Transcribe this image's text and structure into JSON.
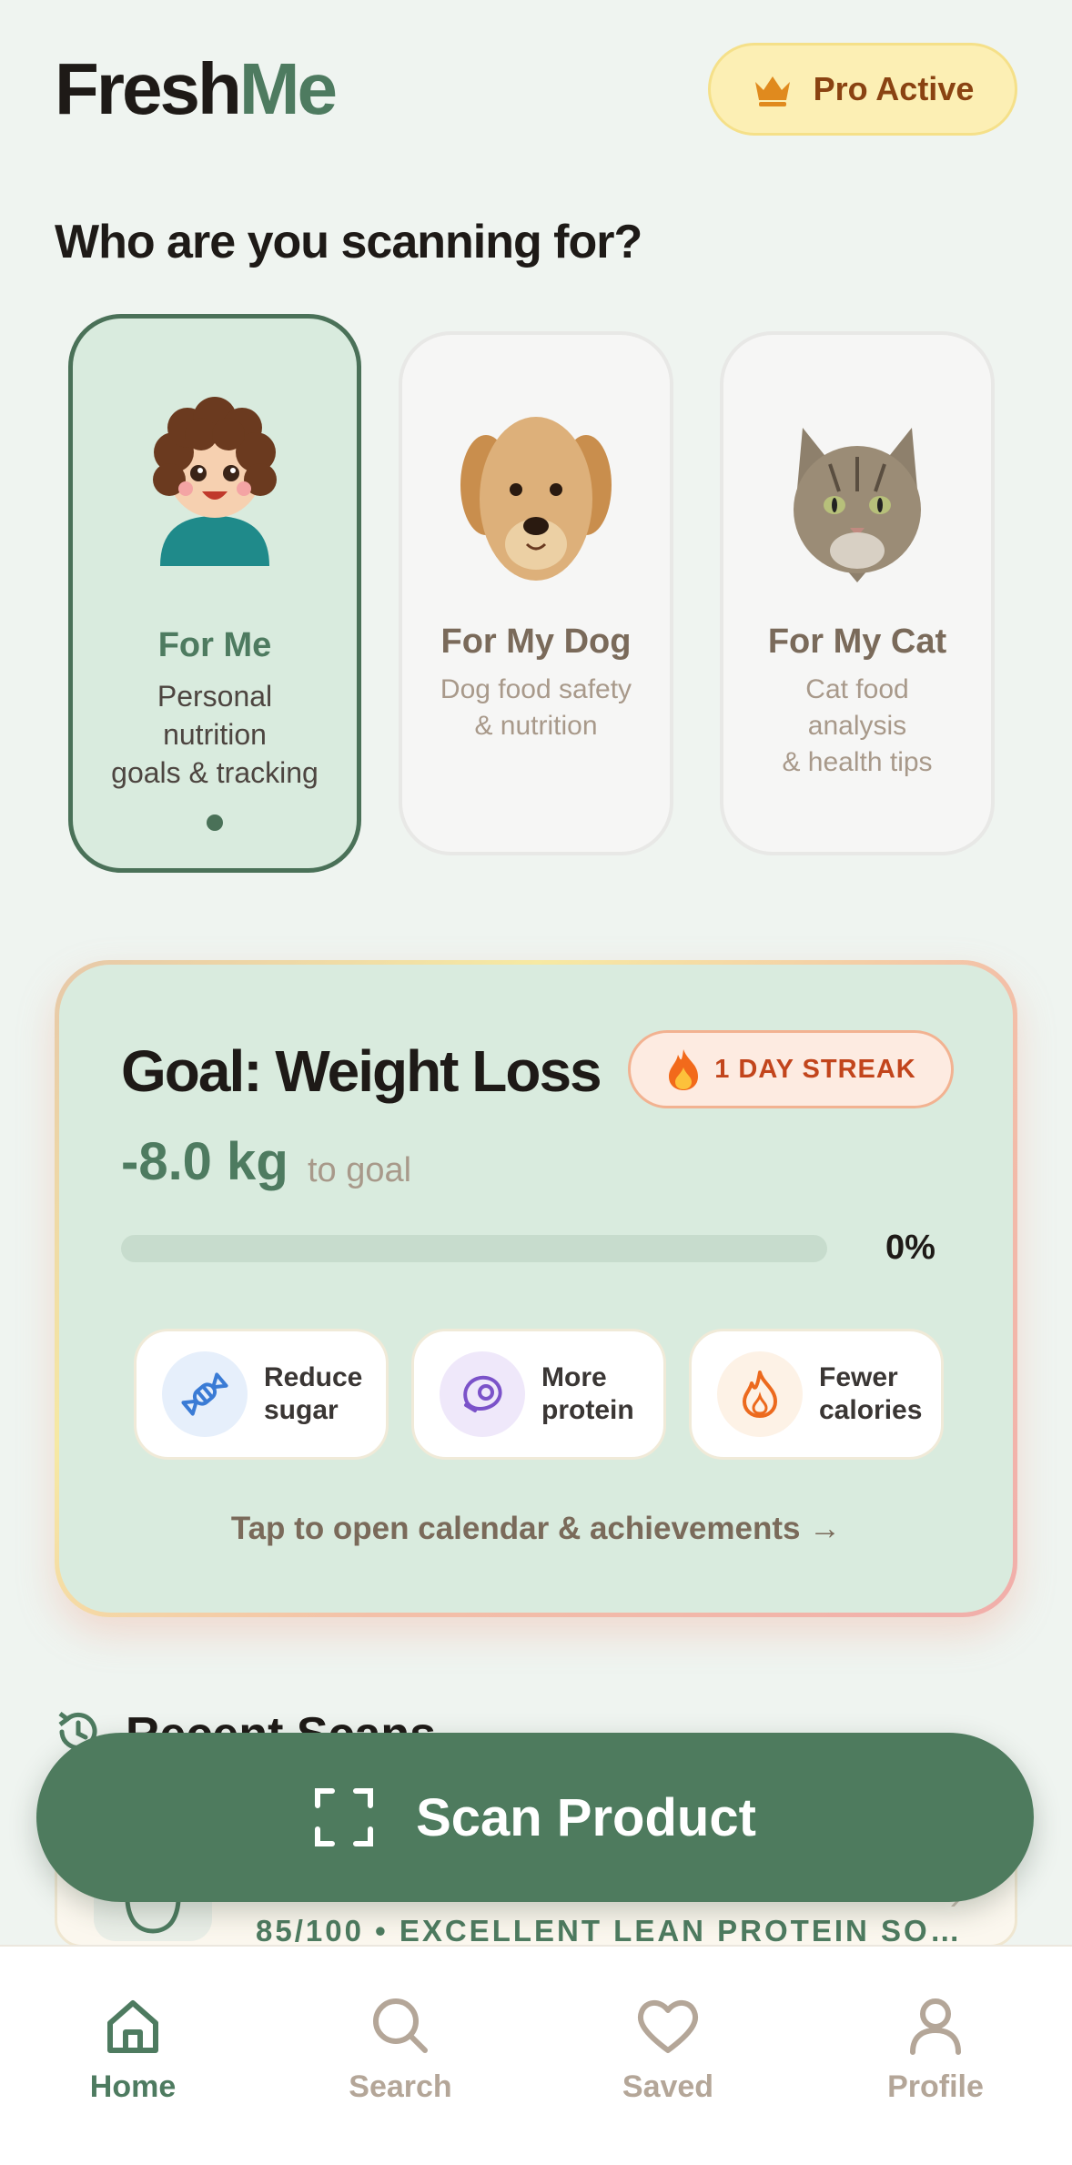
{
  "app": {
    "logo_part1": "Fresh",
    "logo_part2": "Me",
    "pro_badge": "Pro Active"
  },
  "profiles": {
    "heading": "Who are you scanning for?",
    "items": [
      {
        "name": "For Me",
        "desc_lines": [
          "Personal",
          "nutrition",
          "goals & tracking"
        ],
        "active": true
      },
      {
        "name": "For My Dog",
        "desc_lines": [
          "Dog food safety",
          "& nutrition"
        ],
        "active": false
      },
      {
        "name": "For My Cat",
        "desc_lines": [
          "Cat food",
          "analysis",
          "& health tips"
        ],
        "active": false
      }
    ]
  },
  "goal": {
    "title": "Goal: Weight Loss",
    "streak": "1 DAY STREAK",
    "weight_value": "-8.0 kg",
    "weight_suffix": "to goal",
    "progress_percent_label": "0%",
    "progress_fraction": 0,
    "chips": [
      {
        "line1": "Reduce",
        "line2": "sugar",
        "icon": "candy-icon"
      },
      {
        "line1": "More",
        "line2": "protein",
        "icon": "steak-icon"
      },
      {
        "line1": "Fewer",
        "line2": "calories",
        "icon": "flame-icon"
      }
    ],
    "tap_link": "Tap to open calendar & achievements →"
  },
  "recent": {
    "heading": "Recent Scans",
    "item_meta": "85/100 • EXCELLENT LEAN PROTEIN SO…"
  },
  "scan_button": "Scan Product",
  "nav": {
    "items": [
      {
        "label": "Home",
        "icon": "home-icon",
        "active": true
      },
      {
        "label": "Search",
        "icon": "search-icon",
        "active": false
      },
      {
        "label": "Saved",
        "icon": "heart-icon",
        "active": false
      },
      {
        "label": "Profile",
        "icon": "person-icon",
        "active": false
      }
    ]
  },
  "colors": {
    "brand_green": "#4e7b60",
    "background": "#eff4f0",
    "pro_badge_bg": "#fcefb4",
    "streak_orange": "#c2451c"
  }
}
